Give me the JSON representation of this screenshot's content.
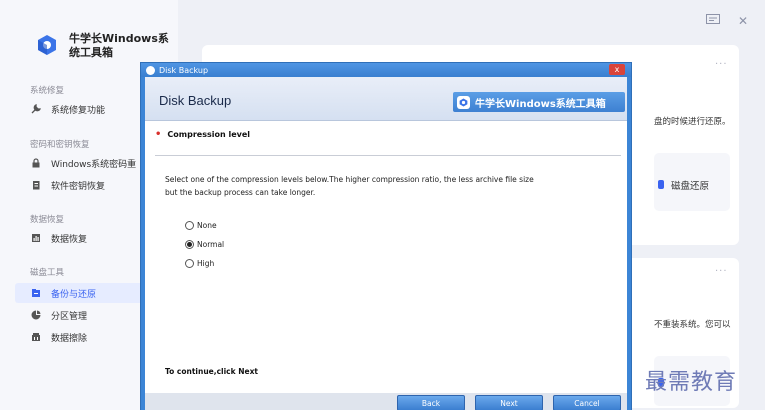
{
  "app": {
    "title": "牛学长Windows系统工具箱",
    "title_line1": "牛学长Windows系",
    "title_line2": "统工具箱"
  },
  "sidebar": {
    "sections": [
      {
        "title": "系统修复",
        "items": [
          {
            "label": "系统修复功能",
            "icon": "wrench-icon"
          }
        ]
      },
      {
        "title": "密码和密钥恢复",
        "items": [
          {
            "label": "Windows系统密码重",
            "icon": "lock-icon"
          },
          {
            "label": "软件密钥恢复",
            "icon": "key-file-icon"
          }
        ]
      },
      {
        "title": "数据恢复",
        "items": [
          {
            "label": "数据恢复",
            "icon": "data-icon"
          }
        ]
      },
      {
        "title": "磁盘工具",
        "items": [
          {
            "label": "备份与还原",
            "icon": "backup-icon",
            "active": true
          },
          {
            "label": "分区管理",
            "icon": "pie-icon"
          },
          {
            "label": "数据擦除",
            "icon": "erase-icon"
          }
        ]
      }
    ]
  },
  "content": {
    "card1_text": "盘的时候进行还原。",
    "card1_inner_label": "磁盘还原",
    "card2_text": "不重装系统。您可以",
    "dots": "···"
  },
  "dialog": {
    "window_title": "Disk Backup",
    "header_title": "Disk Backup",
    "brand": "牛学长Windows系统工具箱",
    "section_title": "Compression level",
    "description_line1": "Select one of the compression levels below.The higher compression ratio, the less archive file size",
    "description_line2": "but the backup process can take longer.",
    "options": [
      "None",
      "Normal",
      "High"
    ],
    "selected_option": "Normal",
    "continue_text": "To continue,click Next",
    "buttons": {
      "back": "Back",
      "next": "Next",
      "cancel": "Cancel"
    },
    "close_label": "x"
  },
  "watermark": "最需教育",
  "colors": {
    "accent": "#3a63f0",
    "dialog_blue": "#3c85d6",
    "close_red": "#d9443a"
  }
}
